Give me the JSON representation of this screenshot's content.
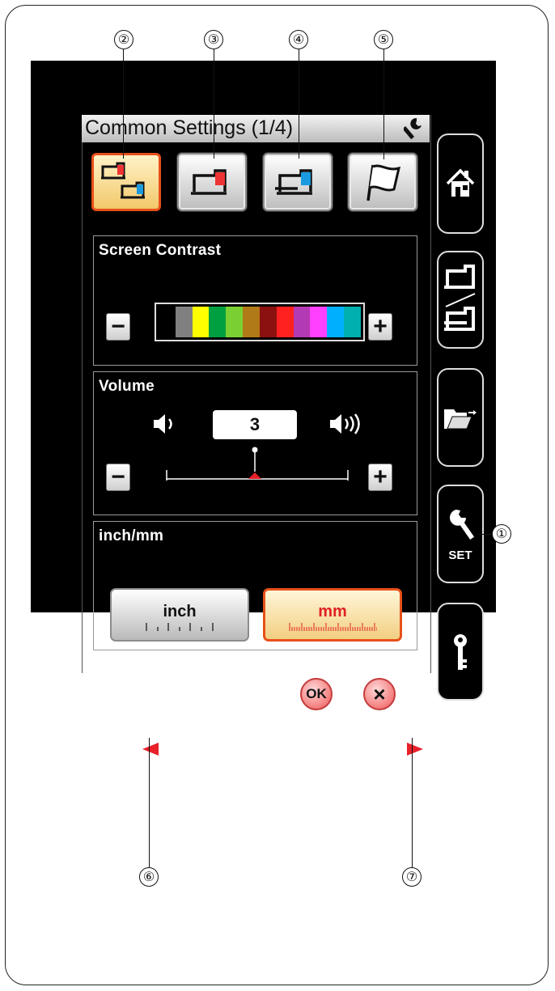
{
  "title": "Common Settings (1/4)",
  "tabs": [
    {
      "name": "common-settings-tab",
      "active": true
    },
    {
      "name": "sewing-settings-tab",
      "active": false
    },
    {
      "name": "embroidery-settings-tab",
      "active": false
    },
    {
      "name": "language-settings-tab",
      "active": false
    }
  ],
  "screen_contrast": {
    "label": "Screen Contrast",
    "minus": "−",
    "plus": "+",
    "colors": [
      "#000000",
      "#808080",
      "#ffff00",
      "#00a040",
      "#7ad032",
      "#b07a18",
      "#8b1010",
      "#ff2020",
      "#b23ab2",
      "#ff40ff",
      "#00b0ff",
      "#00b0b0"
    ]
  },
  "volume": {
    "label": "Volume",
    "value": "3",
    "minus": "−",
    "plus": "+"
  },
  "units": {
    "label": "inch/mm",
    "inch": "inch",
    "mm": "mm",
    "selected": "mm"
  },
  "ok_label": "OK",
  "cancel_label": "×",
  "side": {
    "set_label": "SET"
  },
  "callouts": [
    "①",
    "②",
    "③",
    "④",
    "⑤",
    "⑥",
    "⑦"
  ],
  "colors": {
    "accent": "#e8501a",
    "active_tab_bg": "#f2c86a",
    "arrow": "#e8202a"
  }
}
